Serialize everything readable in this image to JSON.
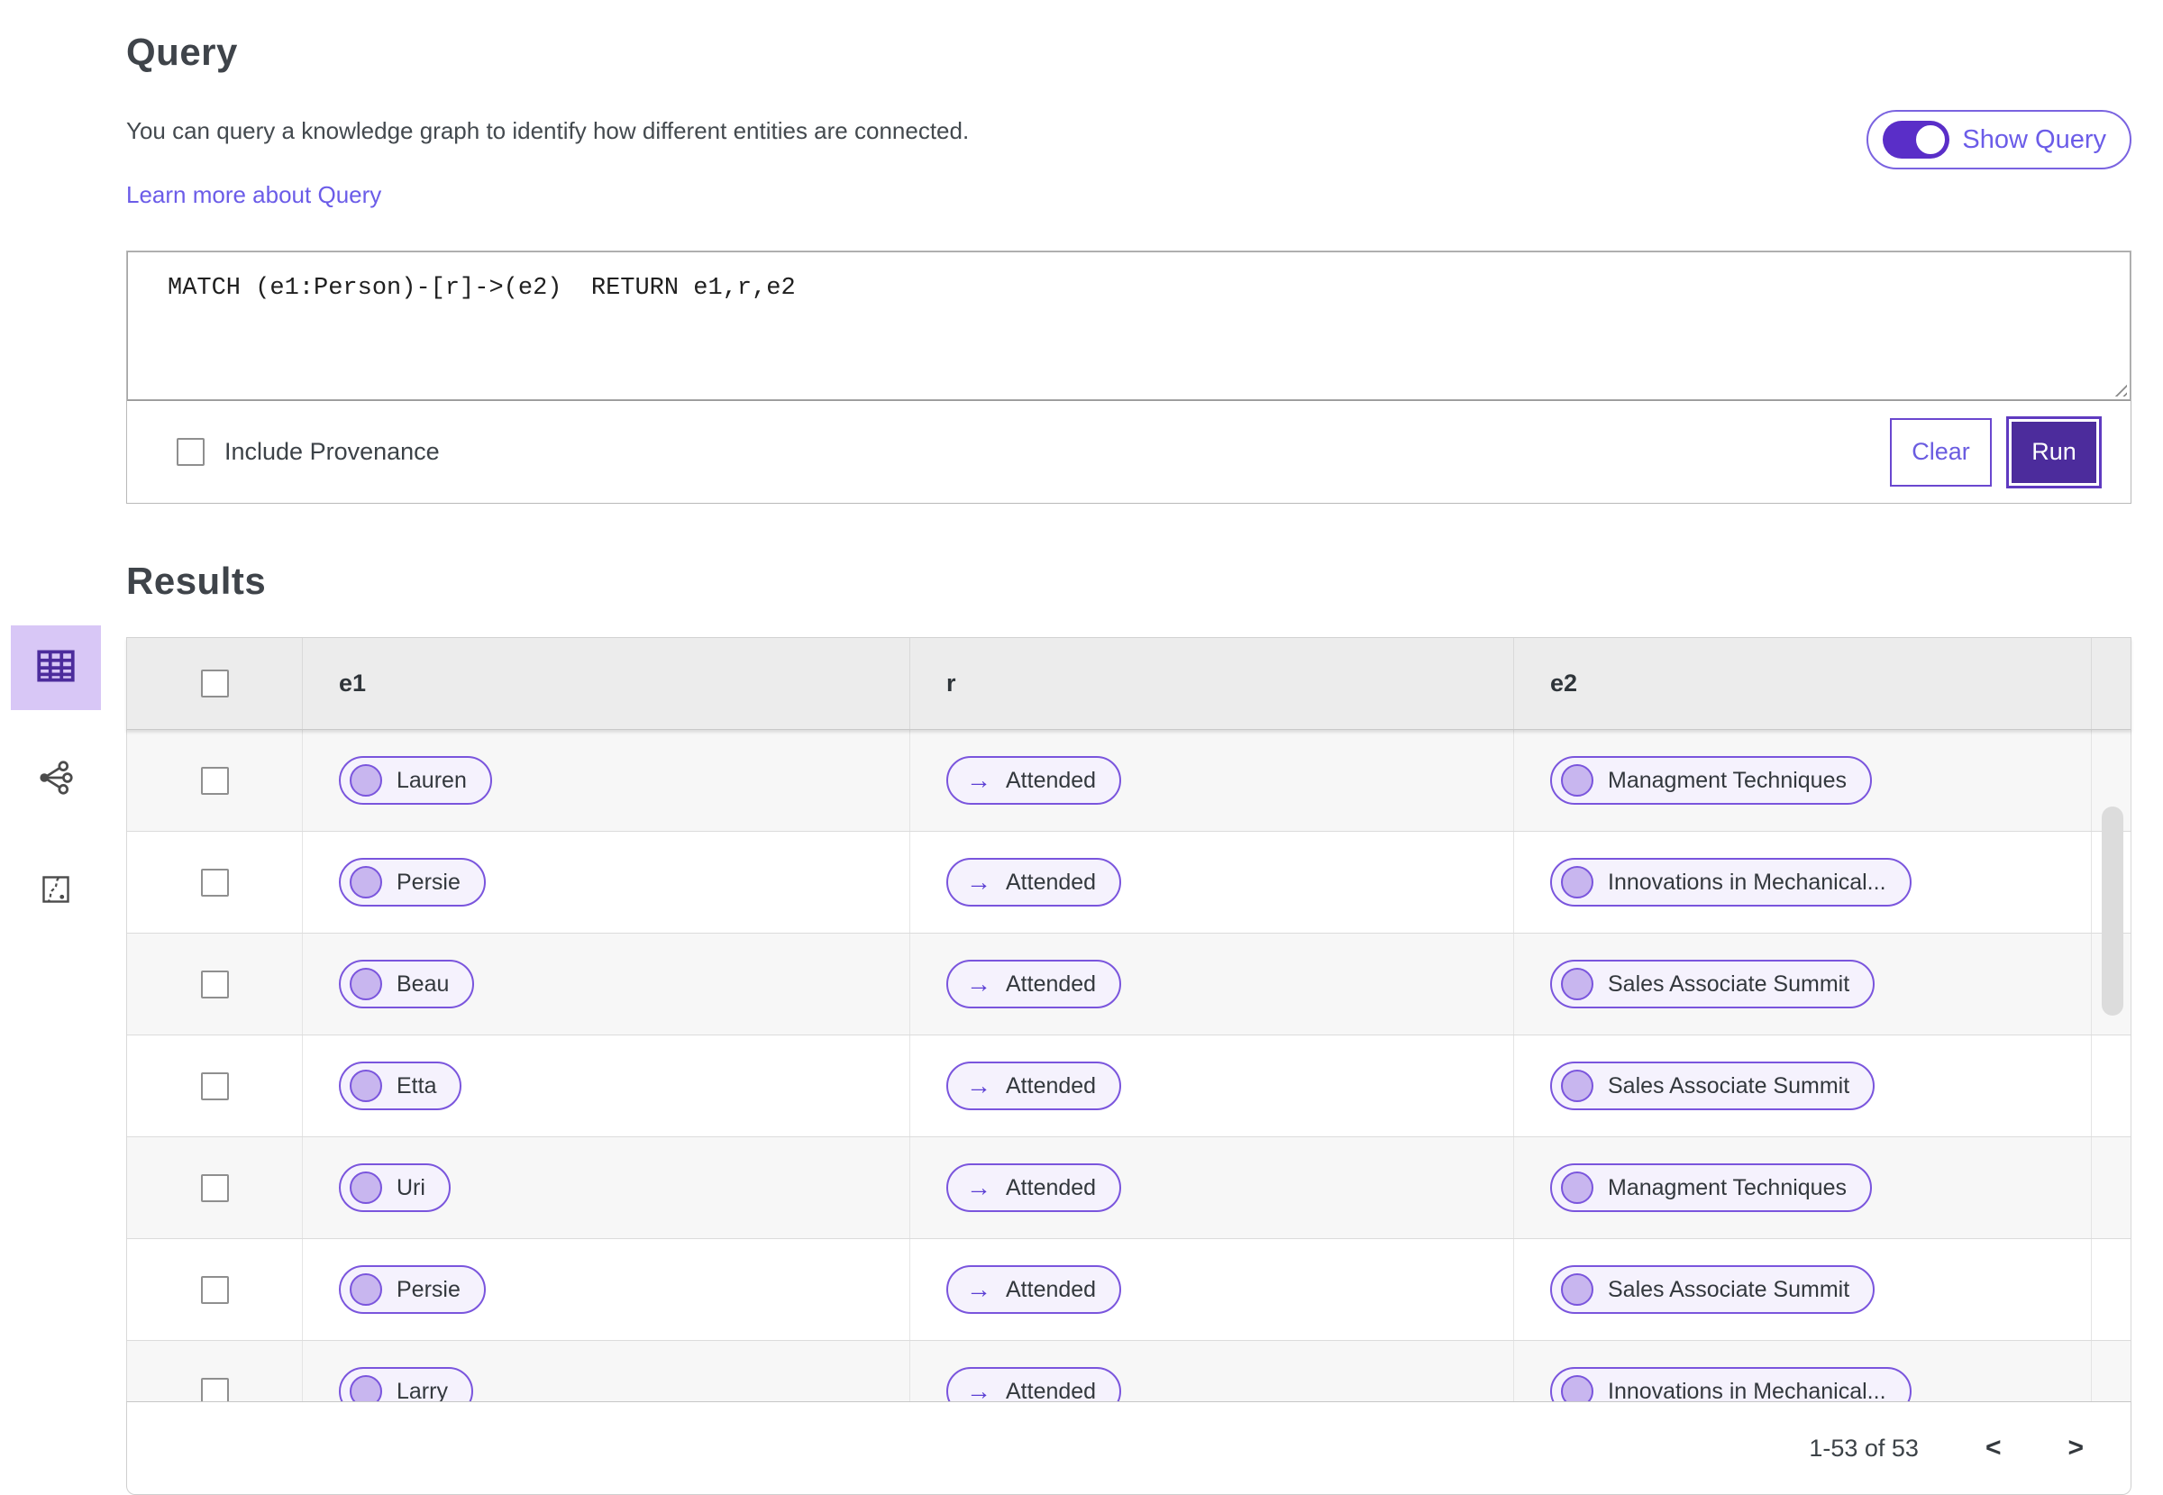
{
  "query_section": {
    "title": "Query",
    "description": "You can query a knowledge graph to identify how different entities are connected.",
    "learn_more_label": "Learn more about Query",
    "show_query_label": "Show Query",
    "query_text": "MATCH (e1:Person)-[r]->(e2)  RETURN e1,r,e2",
    "include_provenance_label": "Include Provenance",
    "clear_button_label": "Clear",
    "run_button_label": "Run"
  },
  "results_section": {
    "title": "Results",
    "view_switcher": {
      "items": [
        {
          "name": "table-view",
          "selected": true
        },
        {
          "name": "network-view",
          "selected": false
        },
        {
          "name": "path-view",
          "selected": false
        }
      ]
    },
    "table": {
      "columns": [
        "e1",
        "r",
        "e2"
      ],
      "relation_arrow_icon": "→",
      "rows": [
        {
          "e1": "Lauren",
          "r": "Attended",
          "e2": "Managment Techniques"
        },
        {
          "e1": "Persie",
          "r": "Attended",
          "e2": "Innovations in Mechanical..."
        },
        {
          "e1": "Beau",
          "r": "Attended",
          "e2": "Sales Associate Summit"
        },
        {
          "e1": "Etta",
          "r": "Attended",
          "e2": "Sales Associate Summit"
        },
        {
          "e1": "Uri",
          "r": "Attended",
          "e2": "Managment Techniques"
        },
        {
          "e1": "Persie",
          "r": "Attended",
          "e2": "Sales Associate Summit"
        },
        {
          "e1": "Larry",
          "r": "Attended",
          "e2": "Innovations in Mechanical..."
        }
      ]
    },
    "pagination": {
      "range_label": "1-53 of 53",
      "prev_icon": "<",
      "next_icon": ">"
    }
  },
  "colors": {
    "accent_purple": "#4c2c9c",
    "toggle_purple": "#5a2ec8",
    "link_purple": "#6b5ce8",
    "pill_border": "#7a55dd",
    "pill_background": "#f5f2fd",
    "node_fill": "#c8b6ef",
    "selected_view_background": "#d8c7f6",
    "table_header_background": "#ececec",
    "row_stripe": "#f7f7f7"
  }
}
